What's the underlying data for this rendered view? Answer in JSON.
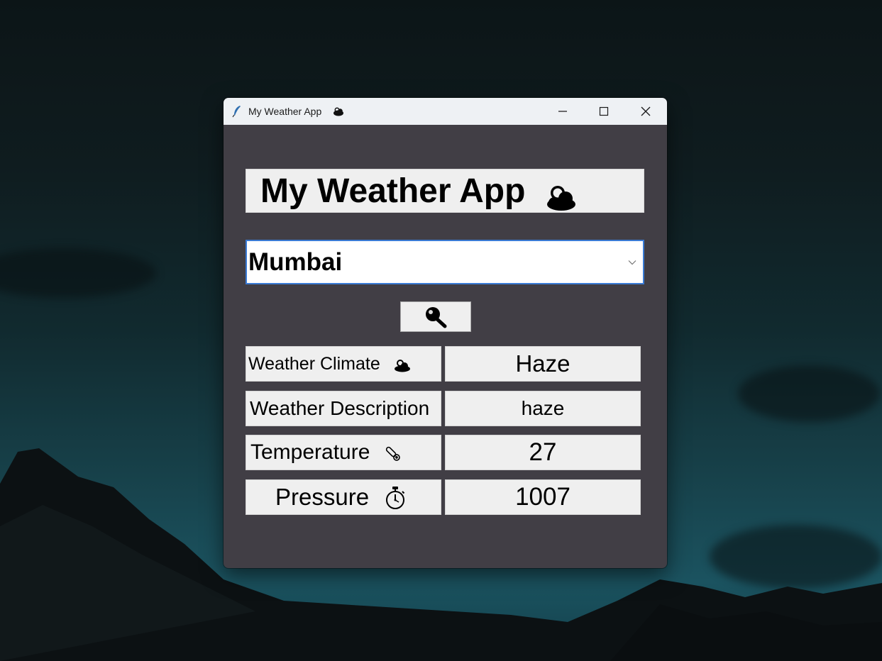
{
  "window": {
    "title": "My Weather App",
    "title_icon": "feather-icon",
    "title_emoji_icon": "cloud-icon",
    "controls": [
      "minimize-icon",
      "maximize-icon",
      "close-icon"
    ]
  },
  "app": {
    "heading": "My Weather App",
    "heading_icon": "cloud-icon",
    "city_value": "Mumbai",
    "search_icon": "magnifier-icon",
    "dropdown_icon": "chevron-down-icon"
  },
  "results": [
    {
      "label": "Weather Climate",
      "icon": "cloud-icon",
      "value": "Haze"
    },
    {
      "label": "Weather Description",
      "icon": "",
      "value": "haze"
    },
    {
      "label": "Temperature",
      "icon": "thermometer-icon",
      "value": "27"
    },
    {
      "label": "Pressure",
      "icon": "stopwatch-icon",
      "value": "1007"
    }
  ],
  "colors": {
    "window_background": "#413e45",
    "titlebar": "#eef1f4",
    "cell_background": "#efefef",
    "input_border_focus": "#3a7bd5"
  }
}
